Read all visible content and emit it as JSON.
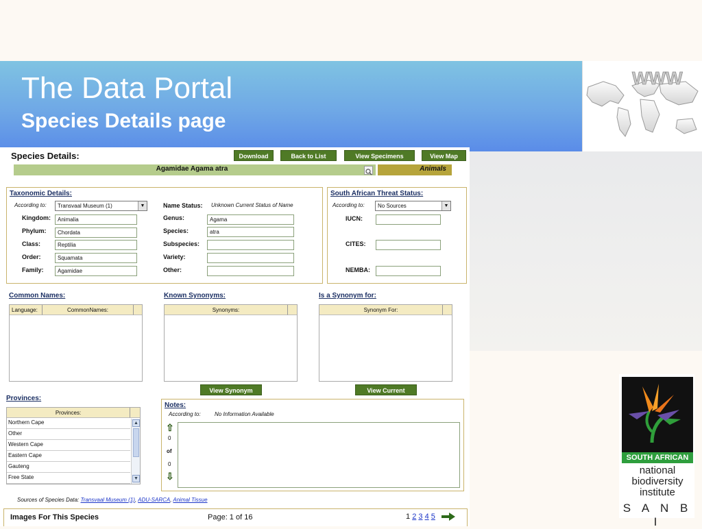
{
  "slide": {
    "title": "The Data Portal",
    "subtitle": "Species Details page"
  },
  "page": {
    "heading": "Species Details:",
    "buttons": {
      "download": "Download",
      "back": "Back to List",
      "specimens": "View Specimens",
      "map": "View Map"
    },
    "species_name": "Agamidae Agama atra",
    "category": "Animals",
    "taxonomic": {
      "title": "Taxonomic Details:",
      "according_label": "According to:",
      "according_value": "Transvaal Museum (1)",
      "left_fields": [
        {
          "label": "Kingdom:",
          "value": "Animalia"
        },
        {
          "label": "Phylum:",
          "value": "Chordata"
        },
        {
          "label": "Class:",
          "value": "Reptilia"
        },
        {
          "label": "Order:",
          "value": "Squamata"
        },
        {
          "label": "Family:",
          "value": "Agamidae"
        }
      ],
      "name_status_label": "Name Status:",
      "name_status_value": "Unknown Current Status of Name",
      "right_fields": [
        {
          "label": "Genus:",
          "value": "Agama"
        },
        {
          "label": "Species:",
          "value": "atra"
        },
        {
          "label": "Subspecies:",
          "value": ""
        },
        {
          "label": "Variety:",
          "value": ""
        },
        {
          "label": "Other:",
          "value": ""
        }
      ]
    },
    "threat": {
      "title": "South African Threat Status:",
      "according_label": "According to:",
      "according_value": "No Sources",
      "fields": [
        {
          "label": "IUCN:",
          "value": ""
        },
        {
          "label": "CITES:",
          "value": ""
        },
        {
          "label": "NEMBA:",
          "value": ""
        }
      ]
    },
    "common_names": {
      "title": "Common Names:",
      "col1": "Language:",
      "col2": "CommonNames:"
    },
    "synonyms": {
      "title": "Known Synonyms:",
      "col": "Synonyms:",
      "button": "View Synonym"
    },
    "synonym_for": {
      "title": "Is a Synonym for:",
      "col": "Synonym For:",
      "button": "View Current"
    },
    "provinces": {
      "title": "Provinces:",
      "col": "Provinces:",
      "items": [
        "Northern Cape",
        "Other",
        "Western Cape",
        "Eastern Cape",
        "Gauteng",
        "Free State"
      ]
    },
    "notes": {
      "title": "Notes:",
      "according_label": "According to:",
      "according_value": "No Information Available",
      "count_a": "0",
      "of": "of",
      "count_b": "0"
    },
    "sources": {
      "label": "Sources of Species Data:",
      "links": [
        "Transvaal Museum (1)",
        "ADU-SARCA",
        "Animal Tissue"
      ]
    },
    "images": {
      "title": "Images For This Species",
      "page_info": "Page: 1 of 16",
      "pages": [
        "1",
        "2",
        "3",
        "4",
        "5"
      ]
    }
  },
  "logo": {
    "band": "SOUTH AFRICAN",
    "line1": "national",
    "line2": "biodiversity",
    "line3": "institute",
    "acronym": "S A N B I"
  },
  "globe_text": "WWW",
  "colors": {
    "button_green": "#4f7a26",
    "name_bar": "#b5cc8c",
    "header_yellow": "#f4ebc2",
    "sanbi_green": "#2e9e3d"
  }
}
